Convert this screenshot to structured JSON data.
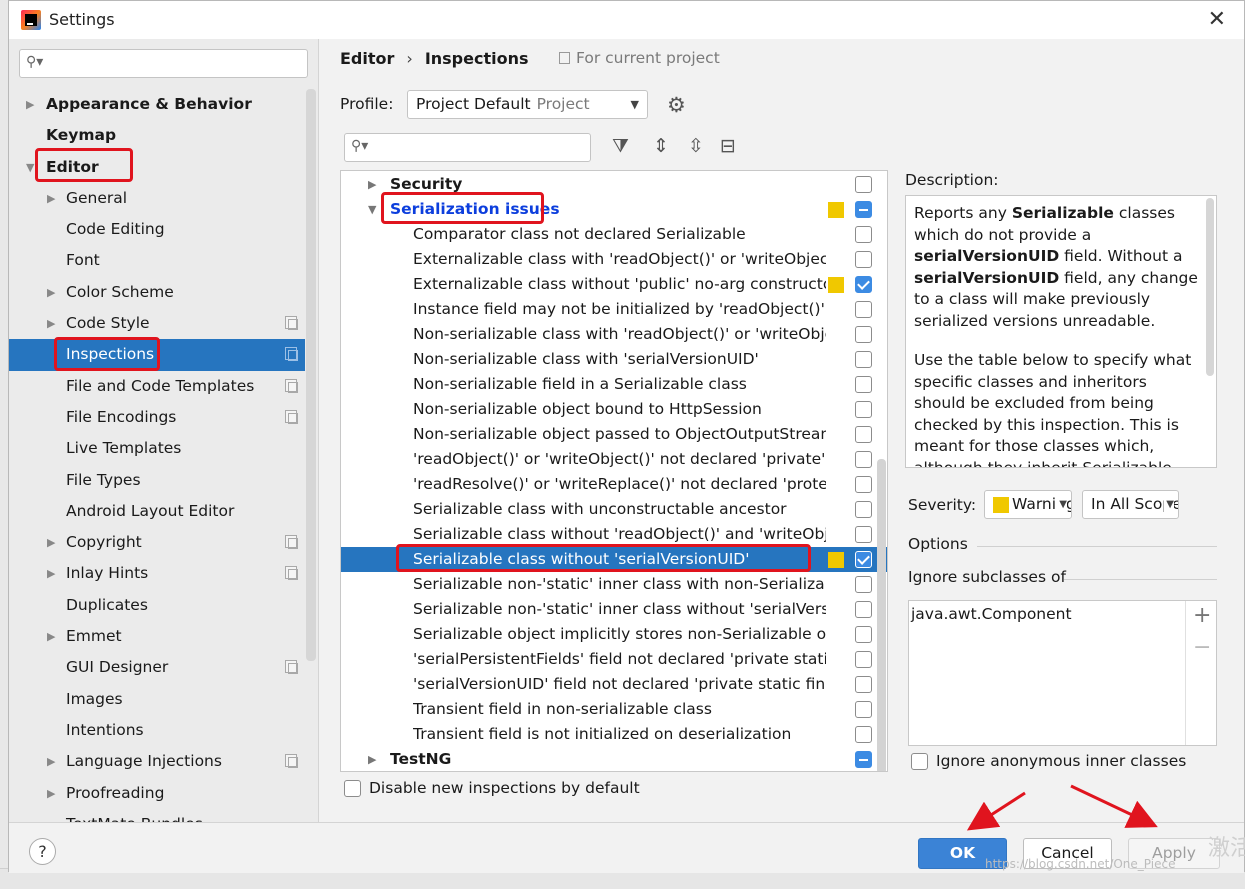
{
  "window": {
    "title": "Settings"
  },
  "sidebar": {
    "items": [
      {
        "label": "Appearance & Behavior",
        "level": 0,
        "arrow": "▶",
        "copy": false
      },
      {
        "label": "Keymap",
        "level": 0,
        "arrow": "",
        "copy": false
      },
      {
        "label": "Editor",
        "level": 0,
        "arrow": "▼",
        "copy": false
      },
      {
        "label": "General",
        "level": 1,
        "arrow": "▶",
        "copy": false
      },
      {
        "label": "Code Editing",
        "level": 1,
        "arrow": "",
        "copy": false
      },
      {
        "label": "Font",
        "level": 1,
        "arrow": "",
        "copy": false
      },
      {
        "label": "Color Scheme",
        "level": 1,
        "arrow": "▶",
        "copy": false
      },
      {
        "label": "Code Style",
        "level": 1,
        "arrow": "▶",
        "copy": true
      },
      {
        "label": "Inspections",
        "level": 1,
        "arrow": "",
        "copy": true,
        "selected": true
      },
      {
        "label": "File and Code Templates",
        "level": 1,
        "arrow": "",
        "copy": true
      },
      {
        "label": "File Encodings",
        "level": 1,
        "arrow": "",
        "copy": true
      },
      {
        "label": "Live Templates",
        "level": 1,
        "arrow": "",
        "copy": false
      },
      {
        "label": "File Types",
        "level": 1,
        "arrow": "",
        "copy": false
      },
      {
        "label": "Android Layout Editor",
        "level": 1,
        "arrow": "",
        "copy": false
      },
      {
        "label": "Copyright",
        "level": 1,
        "arrow": "▶",
        "copy": true
      },
      {
        "label": "Inlay Hints",
        "level": 1,
        "arrow": "▶",
        "copy": true
      },
      {
        "label": "Duplicates",
        "level": 1,
        "arrow": "",
        "copy": false
      },
      {
        "label": "Emmet",
        "level": 1,
        "arrow": "▶",
        "copy": false
      },
      {
        "label": "GUI Designer",
        "level": 1,
        "arrow": "",
        "copy": true
      },
      {
        "label": "Images",
        "level": 1,
        "arrow": "",
        "copy": false
      },
      {
        "label": "Intentions",
        "level": 1,
        "arrow": "",
        "copy": false
      },
      {
        "label": "Language Injections",
        "level": 1,
        "arrow": "▶",
        "copy": true
      },
      {
        "label": "Proofreading",
        "level": 1,
        "arrow": "▶",
        "copy": false
      },
      {
        "label": "TextMate Bundles",
        "level": 1,
        "arrow": "",
        "copy": false
      }
    ]
  },
  "header": {
    "breadcrumb": [
      "Editor",
      "Inspections"
    ],
    "separator": "›",
    "for_project": "For current project"
  },
  "profile": {
    "label": "Profile:",
    "value": "Project Default",
    "suffix": "Project"
  },
  "inspections": {
    "rows": [
      {
        "label": "Security",
        "type": "cat",
        "arrow": "▶",
        "check": "none",
        "severity": false
      },
      {
        "label": "Serialization issues",
        "type": "cat",
        "arrow": "▼",
        "check": "mixed",
        "severity": true,
        "highlight": true
      },
      {
        "label": "Comparator class not declared Serializable",
        "type": "child",
        "check": "none",
        "severity": false
      },
      {
        "label": "Externalizable class with 'readObject()' or 'writeObject()'",
        "type": "child",
        "check": "none",
        "severity": false
      },
      {
        "label": "Externalizable class without 'public' no-arg constructor",
        "type": "child",
        "check": "checked",
        "severity": true
      },
      {
        "label": "Instance field may not be initialized by 'readObject()'",
        "type": "child",
        "check": "none",
        "severity": false
      },
      {
        "label": "Non-serializable class with 'readObject()' or 'writeObject()'",
        "type": "child",
        "check": "none",
        "severity": false
      },
      {
        "label": "Non-serializable class with 'serialVersionUID'",
        "type": "child",
        "check": "none",
        "severity": false
      },
      {
        "label": "Non-serializable field in a Serializable class",
        "type": "child",
        "check": "none",
        "severity": false
      },
      {
        "label": "Non-serializable object bound to HttpSession",
        "type": "child",
        "check": "none",
        "severity": false
      },
      {
        "label": "Non-serializable object passed to ObjectOutputStream",
        "type": "child",
        "check": "none",
        "severity": false
      },
      {
        "label": "'readObject()' or 'writeObject()' not declared 'private'",
        "type": "child",
        "check": "none",
        "severity": false
      },
      {
        "label": "'readResolve()' or 'writeReplace()' not declared 'protected'",
        "type": "child",
        "check": "none",
        "severity": false
      },
      {
        "label": "Serializable class with unconstructable ancestor",
        "type": "child",
        "check": "none",
        "severity": false
      },
      {
        "label": "Serializable class without 'readObject()' and 'writeObject()'",
        "type": "child",
        "check": "none",
        "severity": false
      },
      {
        "label": "Serializable class without 'serialVersionUID'",
        "type": "child",
        "check": "checked",
        "severity": true,
        "selected": true
      },
      {
        "label": "Serializable non-'static' inner class with non-Serializable outer class",
        "type": "child",
        "check": "none",
        "severity": false
      },
      {
        "label": "Serializable non-'static' inner class without 'serialVersionUID'",
        "type": "child",
        "check": "none",
        "severity": false
      },
      {
        "label": "Serializable object implicitly stores non-Serializable object",
        "type": "child",
        "check": "none",
        "severity": false
      },
      {
        "label": "'serialPersistentFields' field not declared 'private static final'",
        "type": "child",
        "check": "none",
        "severity": false
      },
      {
        "label": "'serialVersionUID' field not declared 'private static final long'",
        "type": "child",
        "check": "none",
        "severity": false
      },
      {
        "label": "Transient field in non-serializable class",
        "type": "child",
        "check": "none",
        "severity": false
      },
      {
        "label": "Transient field is not initialized on deserialization",
        "type": "child",
        "check": "none",
        "severity": false
      },
      {
        "label": "TestNG",
        "type": "cat",
        "arrow": "▶",
        "check": "mixed",
        "severity": false
      }
    ],
    "disable_new_label": "Disable new inspections by default"
  },
  "description": {
    "title": "Description:",
    "p1": [
      {
        "t": "Reports any ",
        "b": false
      },
      {
        "t": "Serializable",
        "b": true
      },
      {
        "t": " classes which do not provide a ",
        "b": false
      },
      {
        "t": "serialVersionUID",
        "b": true
      },
      {
        "t": " field. Without a ",
        "b": false
      },
      {
        "t": "serialVersionUID",
        "b": true
      },
      {
        "t": " field, any change to a class will make previously serialized versions unreadable.",
        "b": false
      }
    ],
    "p2": "Use the table below to specify what specific classes and inheritors should be excluded from being checked by this inspection. This is meant for those classes which, although they inherit Serializable from a superclass"
  },
  "severity": {
    "label": "Severity:",
    "value": "Warning",
    "scope": "In All Scopes"
  },
  "options": {
    "title": "Options",
    "ignore_title": "Ignore subclasses of",
    "ignore_items": [
      "java.awt.Component"
    ],
    "anonymous_label": "Ignore anonymous inner classes"
  },
  "footer": {
    "help": "?",
    "ok": "OK",
    "cancel": "Cancel",
    "apply": "Apply"
  },
  "watermark": "https://blog.csdn.net/One_Piece",
  "watermark2": "激活"
}
